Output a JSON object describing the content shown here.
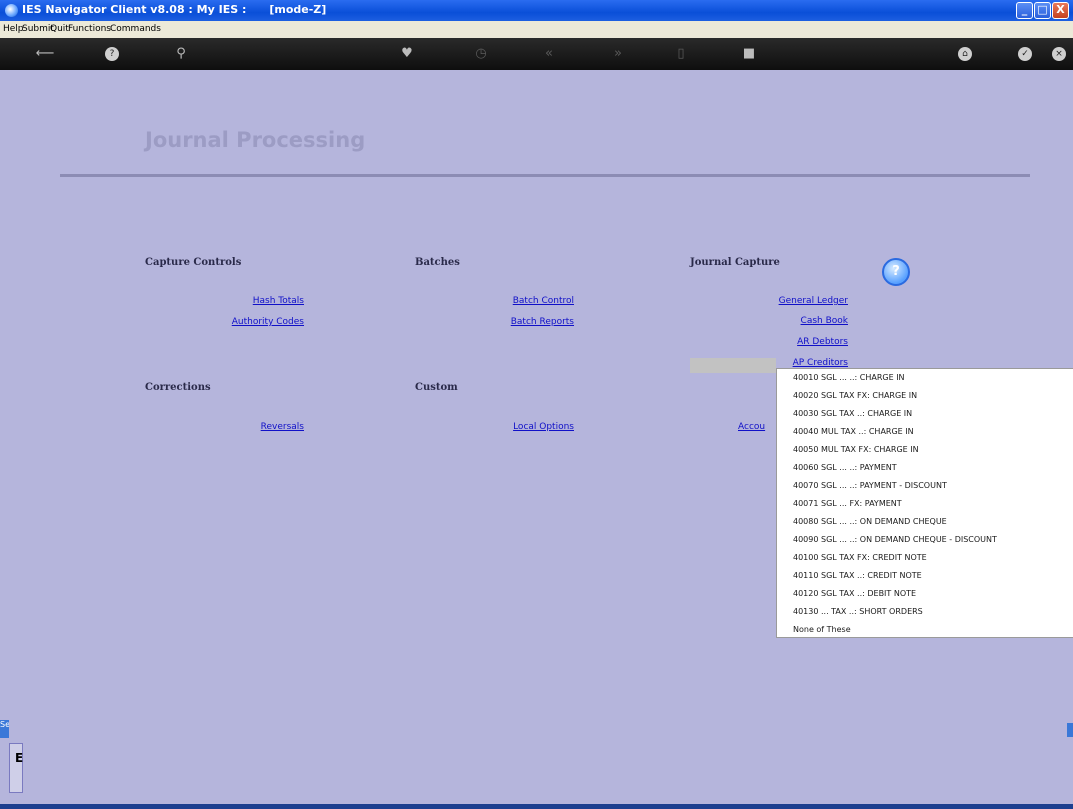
{
  "window": {
    "title": "IES Navigator Client v8.08 : My IES :      [mode-Z]",
    "min_label": "_",
    "max_label": "□",
    "close_label": "X"
  },
  "menu": [
    "Help",
    "Submit",
    "Quit",
    "Functions",
    "Commands"
  ],
  "toolbar_icons": [
    "back-arrow-icon",
    "help-icon",
    "search-icon",
    "favorite-heart-icon",
    "refresh-icon",
    "previous-icon",
    "next-icon",
    "document-icon",
    "stop-icon",
    "home-icon",
    "confirm-icon",
    "close-icon"
  ],
  "page": {
    "heading": "Journal Processing",
    "sections": {
      "capture_controls": "Capture Controls",
      "batches": "Batches",
      "journal_capture": "Journal Capture",
      "corrections": "Corrections",
      "custom": "Custom"
    },
    "links": {
      "hash_totals": "Hash Totals",
      "authority_codes": "Authority Codes",
      "batch_control": "Batch Control",
      "batch_reports": "Batch Reports",
      "general_ledger": "General Ledger",
      "cash_book": "Cash Book",
      "ar_debtors": "AR Debtors",
      "ap_creditors": "AP Creditors",
      "reversals": "Reversals",
      "local_options": "Local Options",
      "accou": "Accou"
    },
    "help_label": "?"
  },
  "popup_items": [
    "40010 SGL ... ..: CHARGE IN",
    "40020 SGL TAX FX: CHARGE IN",
    "40030 SGL TAX ..: CHARGE IN",
    "40040 MUL TAX ..: CHARGE IN",
    "40050 MUL TAX FX: CHARGE IN",
    "40060 SGL ... ..: PAYMENT",
    "40070 SGL ... ..: PAYMENT - DISCOUNT",
    "40071 SGL ... FX: PAYMENT",
    "40080 SGL ... ..: ON DEMAND CHEQUE",
    "40090 SGL ... ..: ON DEMAND CHEQUE - DISCOUNT",
    "40100 SGL TAX FX: CREDIT NOTE",
    "40110 SGL TAX ..: CREDIT NOTE",
    "40120 SGL TAX ..: DEBIT NOTE",
    "40130 ... TAX ..: SHORT ORDERS",
    "None of These"
  ],
  "side": {
    "tab": "Se",
    "letter": "E"
  }
}
